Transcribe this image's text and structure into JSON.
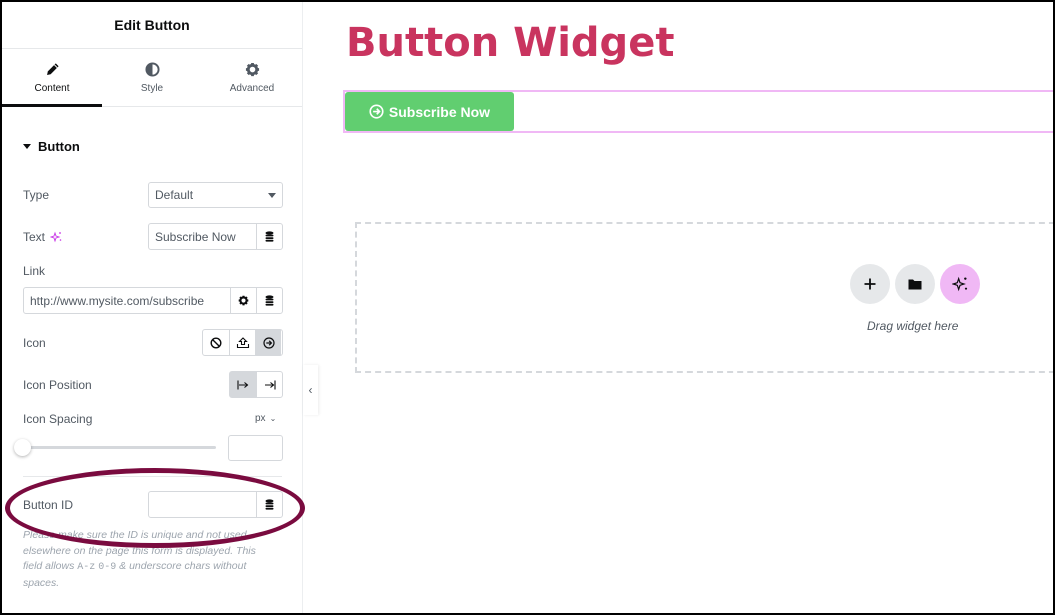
{
  "panel": {
    "title": "Edit Button",
    "tabs": [
      {
        "label": "Content",
        "icon": "pencil-icon",
        "active": true
      },
      {
        "label": "Style",
        "icon": "half-circle-icon",
        "active": false
      },
      {
        "label": "Advanced",
        "icon": "gear-icon",
        "active": false
      }
    ],
    "section": "Button",
    "fields": {
      "type": {
        "label": "Type",
        "value": "Default"
      },
      "text": {
        "label": "Text",
        "value": "Subscribe Now"
      },
      "link": {
        "label": "Link",
        "value": "http://www.mysite.com/subscribe"
      },
      "icon": {
        "label": "Icon",
        "options": [
          "none",
          "upload",
          "arrow-circle-right"
        ],
        "selected": "arrow-circle-right"
      },
      "icon_position": {
        "label": "Icon Position",
        "options": [
          "before",
          "after"
        ],
        "selected": "before"
      },
      "icon_spacing": {
        "label": "Icon Spacing",
        "unit": "px",
        "value": ""
      },
      "button_id": {
        "label": "Button ID",
        "value": ""
      }
    },
    "help_text": {
      "part1": "Please make sure the ID is unique and not used elsewhere on the page this form is displayed. This field allows ",
      "code1": "A-z",
      "code2": "0-9",
      "part2": " & underscore chars without spaces."
    }
  },
  "canvas": {
    "heading": "Button Widget",
    "button_label": "Subscribe Now",
    "dropzone_text": "Drag widget here"
  },
  "colors": {
    "heading": "#c9345f",
    "button_bg": "#61ce70",
    "selection_outline": "#f0b8f5",
    "annotation": "#7a0b3f"
  }
}
